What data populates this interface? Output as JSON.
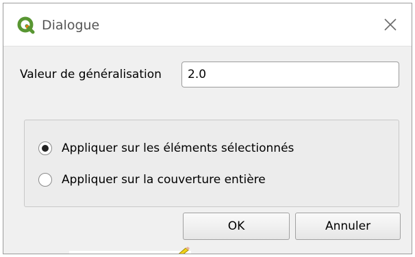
{
  "window": {
    "title": "Dialogue",
    "icon": "qgis-logo-icon",
    "close_icon": "close-icon"
  },
  "form": {
    "label": "Valeur de généralisation",
    "value": "2.0"
  },
  "options": {
    "items": [
      {
        "label": "Appliquer sur les éléments sélectionnés",
        "selected": true
      },
      {
        "label": "Appliquer sur la couverture entière",
        "selected": false
      }
    ]
  },
  "buttons": {
    "ok_label": "OK",
    "cancel_label": "Annuler"
  },
  "colors": {
    "qgis_green": "#589632",
    "qgis_yellow": "#ee7913"
  }
}
